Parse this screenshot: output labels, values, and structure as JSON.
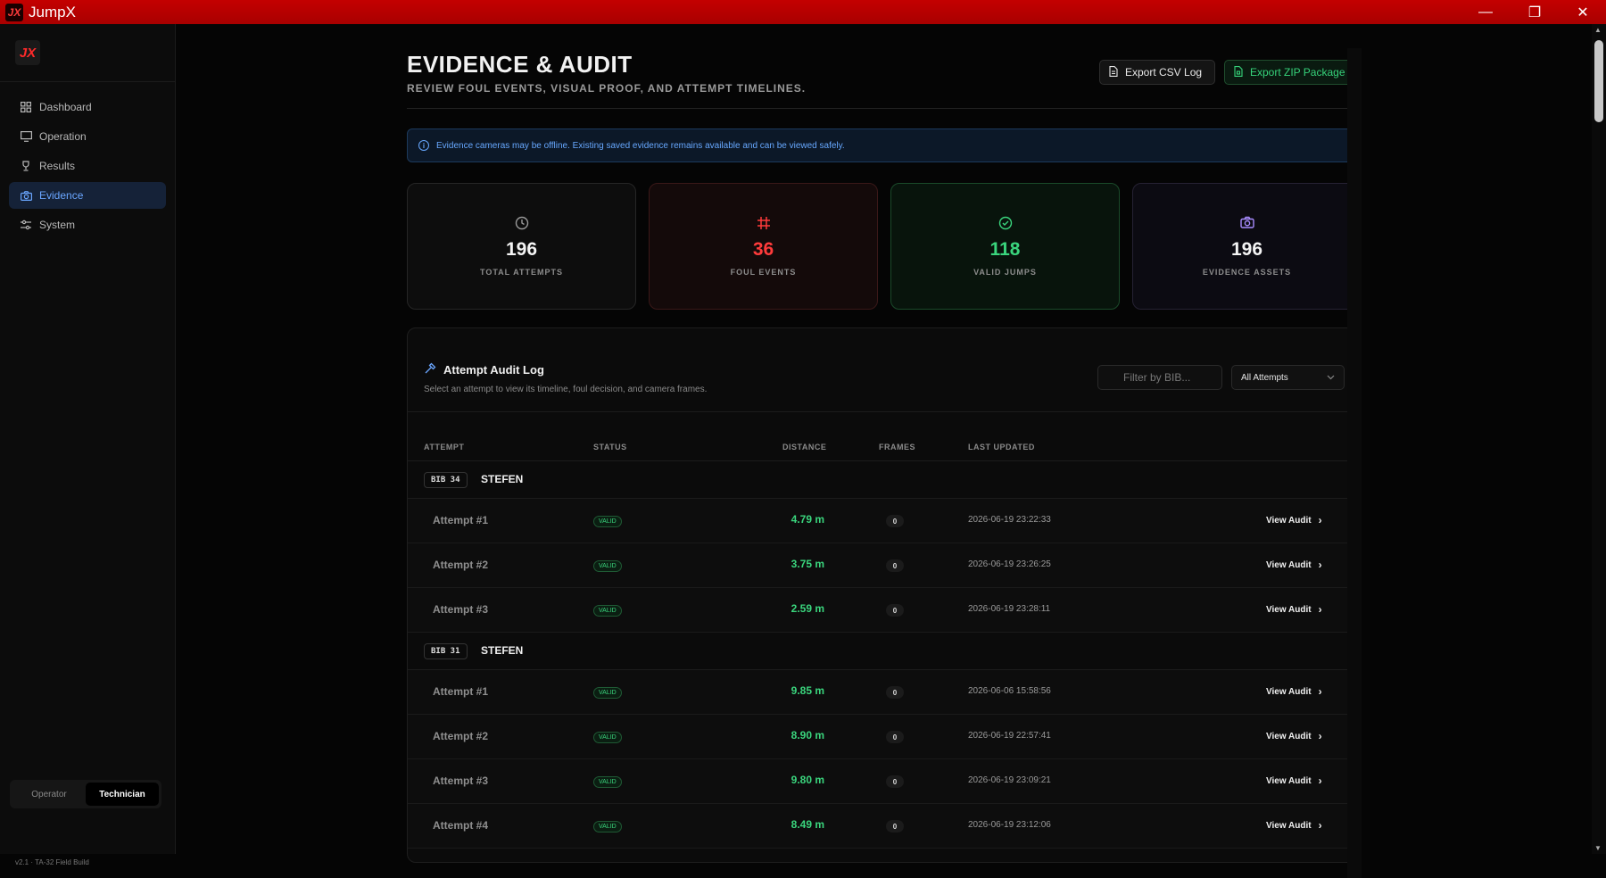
{
  "app": {
    "title": "JumpX",
    "logo_text": "JX"
  },
  "sidebar": {
    "items": [
      {
        "label": "Dashboard",
        "icon": "grid-icon"
      },
      {
        "label": "Operation",
        "icon": "monitor-icon"
      },
      {
        "label": "Results",
        "icon": "trophy-icon"
      },
      {
        "label": "Evidence",
        "icon": "camera-icon",
        "active": true
      },
      {
        "label": "System",
        "icon": "sliders-icon"
      }
    ],
    "roles": [
      "Operator",
      "Technician"
    ],
    "active_role": "Technician",
    "build": "v2.1 · TA-32 Field Build"
  },
  "header": {
    "title": "EVIDENCE & AUDIT",
    "subtitle": "REVIEW FOUL EVENTS, VISUAL PROOF, AND ATTEMPT TIMELINES.",
    "export_csv": "Export CSV Log",
    "export_zip": "Export ZIP Package"
  },
  "alert": "Evidence cameras may be offline. Existing saved evidence remains available and can be viewed safely.",
  "stats": [
    {
      "value": "196",
      "label": "TOTAL ATTEMPTS"
    },
    {
      "value": "36",
      "label": "FOUL EVENTS"
    },
    {
      "value": "118",
      "label": "VALID JUMPS"
    },
    {
      "value": "196",
      "label": "EVIDENCE ASSETS"
    }
  ],
  "audit": {
    "title": "Attempt Audit Log",
    "subtitle": "Select an attempt to view its timeline, foul decision, and camera frames.",
    "filter_placeholder": "Filter by BIB...",
    "select_value": "All Attempts",
    "columns": {
      "attempt": "ATTEMPT",
      "status": "STATUS",
      "distance": "DISTANCE",
      "frames": "FRAMES",
      "updated": "LAST UPDATED"
    },
    "view_label": "View Audit",
    "groups": [
      {
        "bib": "BIB 34",
        "name": "STEFEN",
        "rows": [
          {
            "attempt": "Attempt #1",
            "status": "VALID",
            "distance": "4.79 m",
            "frames": "0",
            "updated": "2026-06-19 23:22:33"
          },
          {
            "attempt": "Attempt #2",
            "status": "VALID",
            "distance": "3.75 m",
            "frames": "0",
            "updated": "2026-06-19 23:26:25"
          },
          {
            "attempt": "Attempt #3",
            "status": "VALID",
            "distance": "2.59 m",
            "frames": "0",
            "updated": "2026-06-19 23:28:11"
          }
        ]
      },
      {
        "bib": "BIB 31",
        "name": "STEFEN",
        "rows": [
          {
            "attempt": "Attempt #1",
            "status": "VALID",
            "distance": "9.85 m",
            "frames": "0",
            "updated": "2026-06-06 15:58:56"
          },
          {
            "attempt": "Attempt #2",
            "status": "VALID",
            "distance": "8.90 m",
            "frames": "0",
            "updated": "2026-06-19 22:57:41"
          },
          {
            "attempt": "Attempt #3",
            "status": "VALID",
            "distance": "9.80 m",
            "frames": "0",
            "updated": "2026-06-19 23:09:21"
          },
          {
            "attempt": "Attempt #4",
            "status": "VALID",
            "distance": "8.49 m",
            "frames": "0",
            "updated": "2026-06-19 23:12:06"
          }
        ]
      }
    ]
  }
}
